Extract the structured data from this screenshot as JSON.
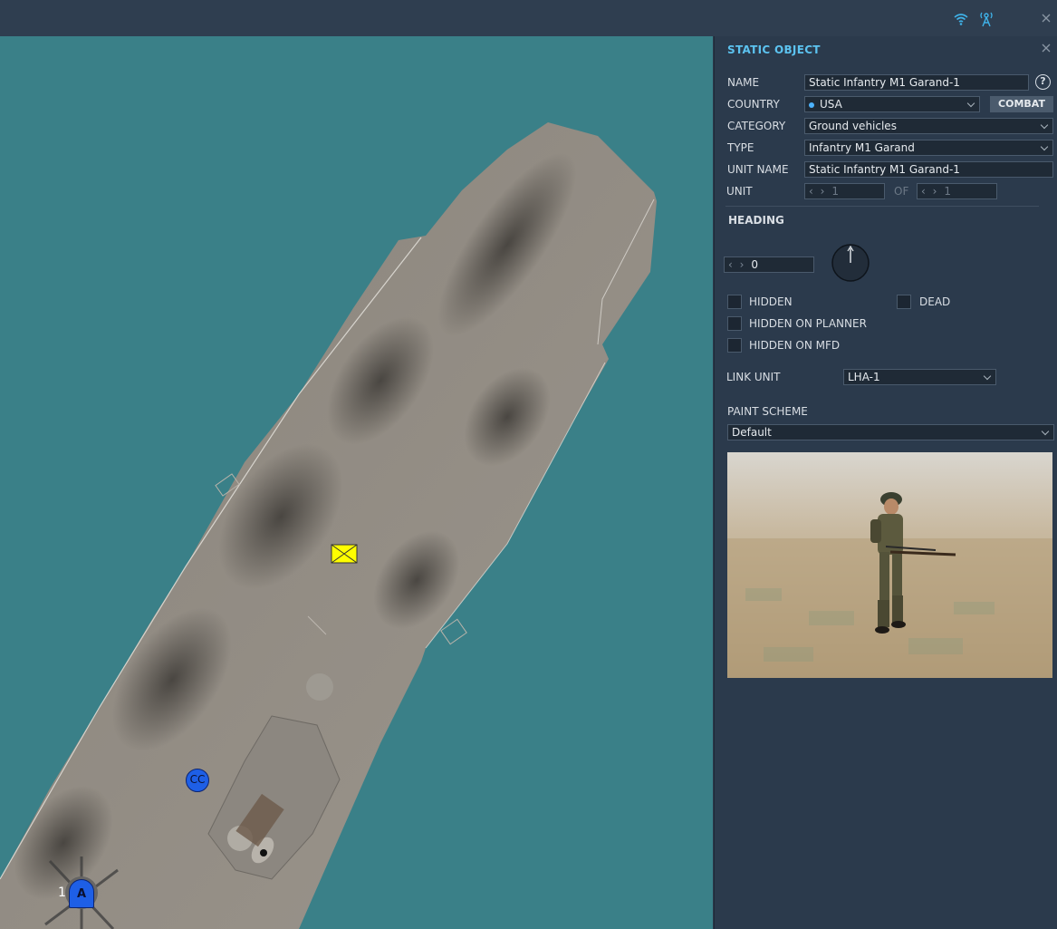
{
  "panel": {
    "title": "STATIC OBJECT",
    "help_label": "?",
    "name_label": "NAME",
    "name_value": "Static Infantry M1 Garand-1",
    "country_label": "COUNTRY",
    "country_value": "USA",
    "combat_label": "COMBAT",
    "category_label": "CATEGORY",
    "category_value": "Ground vehicles",
    "type_label": "TYPE",
    "type_value": "Infantry M1 Garand",
    "unit_name_label": "UNIT NAME",
    "unit_name_value": "Static Infantry M1 Garand-1",
    "unit_label": "UNIT",
    "unit_value": "1",
    "of_label": "OF",
    "of_value": "1",
    "heading_title": "HEADING",
    "heading_value": "0",
    "hidden_label": "HIDDEN",
    "dead_label": "DEAD",
    "hidden_planner_label": "HIDDEN ON PLANNER",
    "hidden_mfd_label": "HIDDEN ON MFD",
    "link_unit_label": "LINK UNIT",
    "link_unit_value": "LHA-1",
    "paint_scheme_label": "PAINT SCHEME",
    "paint_scheme_value": "Default",
    "arrows_glyph": "‹ ›"
  },
  "map": {
    "cc_marker_label": "CC",
    "unit_marker_label": "A",
    "unit_number": "1"
  },
  "colors": {
    "accent": "#5cc3f0",
    "water": "#3a8088",
    "panel_bg": "#2b3a4c",
    "marker_blue": "#1e5fe6",
    "marker_yellow": "#ffff00"
  },
  "icons": {
    "topbar": [
      "wifi-icon",
      "antenna-icon",
      "close-icon"
    ],
    "panel": [
      "close-icon",
      "help-icon",
      "heading-dial-icon"
    ]
  }
}
